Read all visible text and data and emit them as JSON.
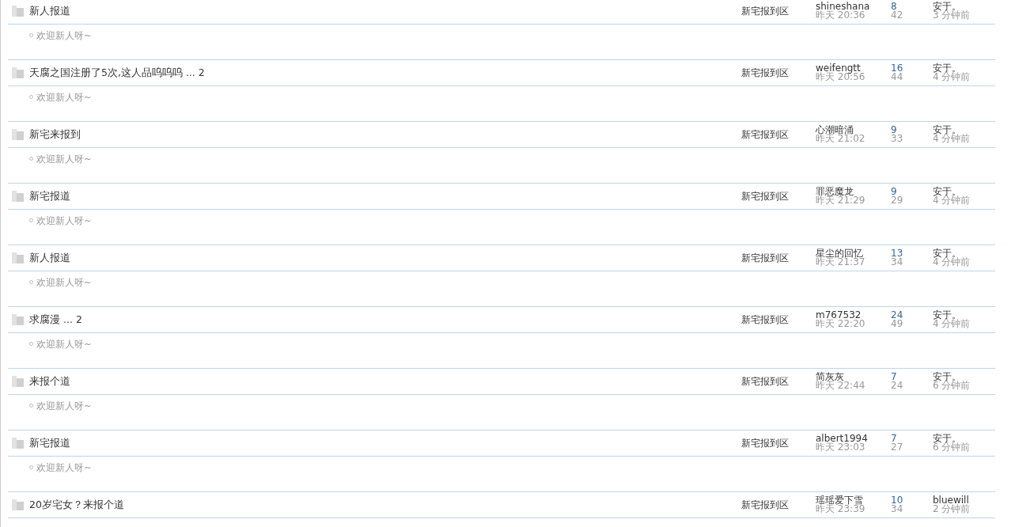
{
  "threads": [
    {
      "title": "新人报道",
      "forum": "新宅报到区",
      "author": "shineshana",
      "posted": "昨天 20:36",
      "replies": "8",
      "views": "42",
      "last_user": "安于。",
      "last_time": "3 分钟前",
      "excerpt": "欢迎新人呀~"
    },
    {
      "title": "天腐之国注册了5次,这人品呜呜呜 ...",
      "pages": "2",
      "forum": "新宅报到区",
      "author": "weifengtt",
      "posted": "昨天 20:56",
      "replies": "16",
      "views": "44",
      "last_user": "安于。",
      "last_time": "4 分钟前",
      "excerpt": "欢迎新人呀~"
    },
    {
      "title": "新宅来报到",
      "forum": "新宅报到区",
      "author": "心潮暗涌",
      "posted": "昨天 21:02",
      "replies": "9",
      "views": "33",
      "last_user": "安于。",
      "last_time": "4 分钟前",
      "excerpt": "欢迎新人呀~"
    },
    {
      "title": "新宅报道",
      "forum": "新宅报到区",
      "author": "罪恶魔龙",
      "posted": "昨天 21:29",
      "replies": "9",
      "views": "29",
      "last_user": "安于。",
      "last_time": "4 分钟前",
      "excerpt": "欢迎新人呀~"
    },
    {
      "title": "新人报道",
      "forum": "新宅报到区",
      "author": "星尘的回忆",
      "posted": "昨天 21:37",
      "replies": "13",
      "views": "34",
      "last_user": "安于。",
      "last_time": "4 分钟前",
      "excerpt": "欢迎新人呀~"
    },
    {
      "title": "求腐漫 ...",
      "pages": "2",
      "forum": "新宅报到区",
      "author": "m767532",
      "posted": "昨天 22:20",
      "replies": "24",
      "views": "49",
      "last_user": "安于。",
      "last_time": "4 分钟前",
      "excerpt": "欢迎新人呀~"
    },
    {
      "title": "来报个道",
      "forum": "新宅报到区",
      "author": "简灰灰",
      "posted": "昨天 22:44",
      "replies": "7",
      "views": "24",
      "last_user": "安于。",
      "last_time": "6 分钟前",
      "excerpt": "欢迎新人呀~"
    },
    {
      "title": "新宅报道",
      "forum": "新宅报到区",
      "author": "albert1994",
      "posted": "昨天 23:03",
      "replies": "7",
      "views": "27",
      "last_user": "安于。",
      "last_time": "6 分钟前",
      "excerpt": "欢迎新人呀~"
    },
    {
      "title": "20岁宅女？来报个道",
      "forum": "新宅报到区",
      "author": "瑶瑶爱下雪",
      "posted": "昨天 23:39",
      "replies": "10",
      "views": "34",
      "last_user": "bluewill",
      "last_time": "2 分钟前"
    }
  ]
}
